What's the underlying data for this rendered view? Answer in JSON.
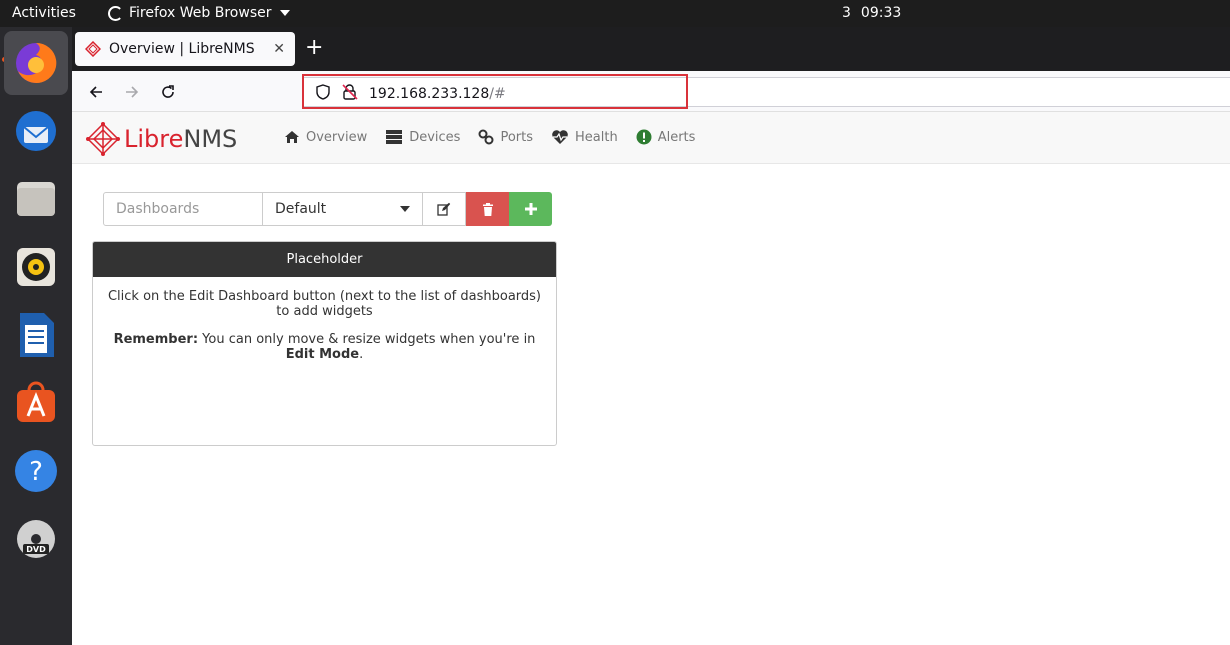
{
  "topbar": {
    "activities": "Activities",
    "app_name": "Firefox Web Browser",
    "clock_prefix": "3",
    "clock_time": "09:33"
  },
  "dock": {
    "items": [
      "firefox-icon",
      "thunderbird-icon",
      "files-icon",
      "rhythmbox-icon",
      "libreoffice-writer-icon",
      "app-center-icon",
      "help-icon",
      "dvd-icon"
    ]
  },
  "browser": {
    "tab_title": "Overview | LibreNMS",
    "url_host": "192.168.233.128",
    "url_path": "/#"
  },
  "librenms": {
    "brand_libre": "Libre",
    "brand_nms": "NMS",
    "menu": [
      {
        "label": "Overview",
        "icon": "home-icon"
      },
      {
        "label": "Devices",
        "icon": "server-icon"
      },
      {
        "label": "Ports",
        "icon": "link-icon"
      },
      {
        "label": "Health",
        "icon": "heartbeat-icon"
      },
      {
        "label": "Alerts",
        "icon": "exclamation-circle-icon"
      }
    ],
    "dash_placeholder": "Dashboards",
    "dash_selected": "Default",
    "widget_title": "Placeholder",
    "widget_text1": "Click on the Edit Dashboard button (next to the list of dashboards) to add widgets",
    "widget_remember_bold": "Remember:",
    "widget_remember_text": " You can only move & resize widgets when you're in ",
    "widget_editmode_bold": "Edit Mode",
    "widget_remember_end": "."
  },
  "colors": {
    "brand_red": "#d9232e",
    "delete_red": "#d9534f",
    "add_green": "#5cb85c",
    "widget_header": "#333333",
    "url_highlight": "#d9323a"
  }
}
